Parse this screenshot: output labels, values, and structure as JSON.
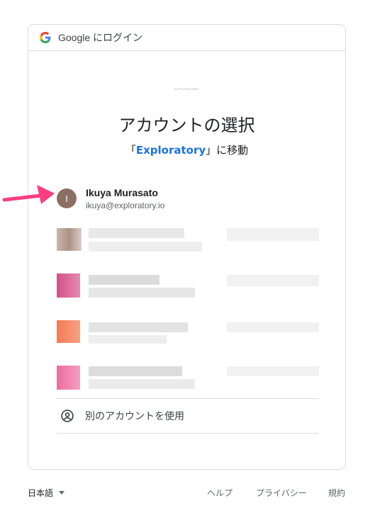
{
  "header": {
    "title": "Google にログイン"
  },
  "brand": {
    "small_label": "EXPLORATORY"
  },
  "main": {
    "heading": "アカウントの選択",
    "subtitle_open": "「",
    "subtitle_app": "Exploratory",
    "subtitle_close": "」に移動"
  },
  "account": {
    "avatar_initial": "I",
    "name": "Ikuya Murasato",
    "email": "ikuya@exploratory.io"
  },
  "use_other": {
    "label": "別のアカウントを使用",
    "icon": "account-circle-icon"
  },
  "footer": {
    "language": "日本語",
    "help": "ヘルプ",
    "privacy": "プライバシー",
    "terms": "規約"
  },
  "colors": {
    "link": "#1a73e8",
    "arrow": "#ff3d7f",
    "avatar": "#8d6e63",
    "border": "#dadce0"
  }
}
